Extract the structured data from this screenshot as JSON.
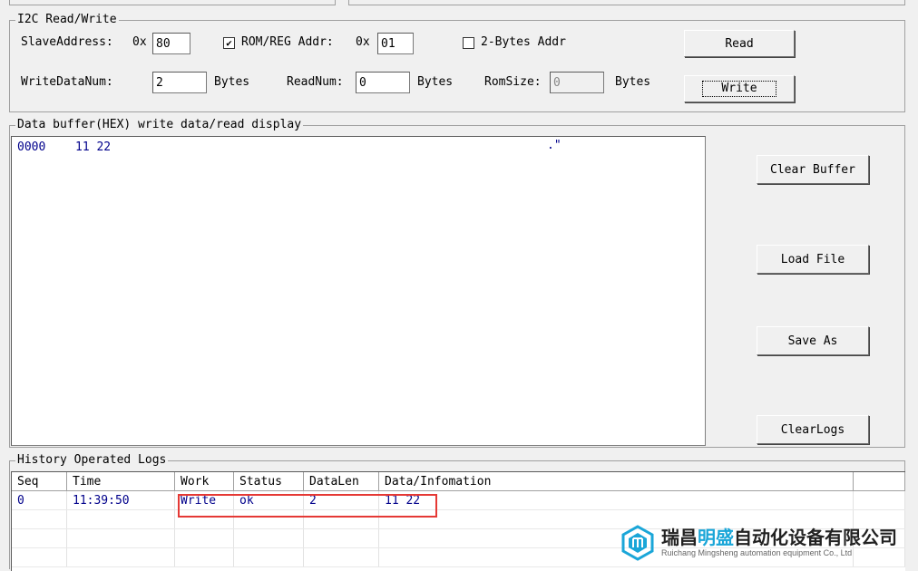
{
  "i2c_group": {
    "title": "I2C Read/Write",
    "slave_address_label": "SlaveAddress:",
    "hex_prefix_1": "0x",
    "slave_address_value": "80",
    "rom_reg_checked": "✔",
    "rom_reg_label": "ROM/REG Addr:",
    "hex_prefix_2": "0x",
    "rom_reg_value": "01",
    "two_bytes_label": "2-Bytes Addr",
    "read_button": "Read",
    "write_data_num_label": "WriteDataNum:",
    "write_data_num_value": "2",
    "bytes_label_1": "Bytes",
    "read_num_label": "ReadNum:",
    "read_num_value": "0",
    "bytes_label_2": "Bytes",
    "rom_size_label": "RomSize:",
    "rom_size_value": "0",
    "bytes_label_3": "Bytes",
    "write_button": "Write"
  },
  "buffer_group": {
    "title": "Data buffer(HEX) write data/read display",
    "line_offset": "0000",
    "line_data": "11 22",
    "line_ascii": ".\"",
    "clear_buffer_button": "Clear Buffer",
    "load_file_button": "Load File",
    "save_as_button": "Save As",
    "clear_logs_button": "ClearLogs"
  },
  "logs_group": {
    "title": "History Operated Logs",
    "columns": [
      "Seq",
      "Time",
      "Work",
      "Status",
      "DataLen",
      "Data/Infomation"
    ],
    "rows": [
      [
        "0",
        "11:39:50",
        "Write",
        "ok",
        "2",
        "11 22"
      ]
    ]
  },
  "brand": {
    "name_part1": "瑞昌",
    "name_accent": "明盛",
    "name_part2": "自动化设备有限公司",
    "sub": "Ruichang Mingsheng automation equipment Co., Ltd"
  },
  "colors": {
    "data_text": "#00008b",
    "highlight_border": "#e53935",
    "brand_accent": "#1aa6d8"
  }
}
